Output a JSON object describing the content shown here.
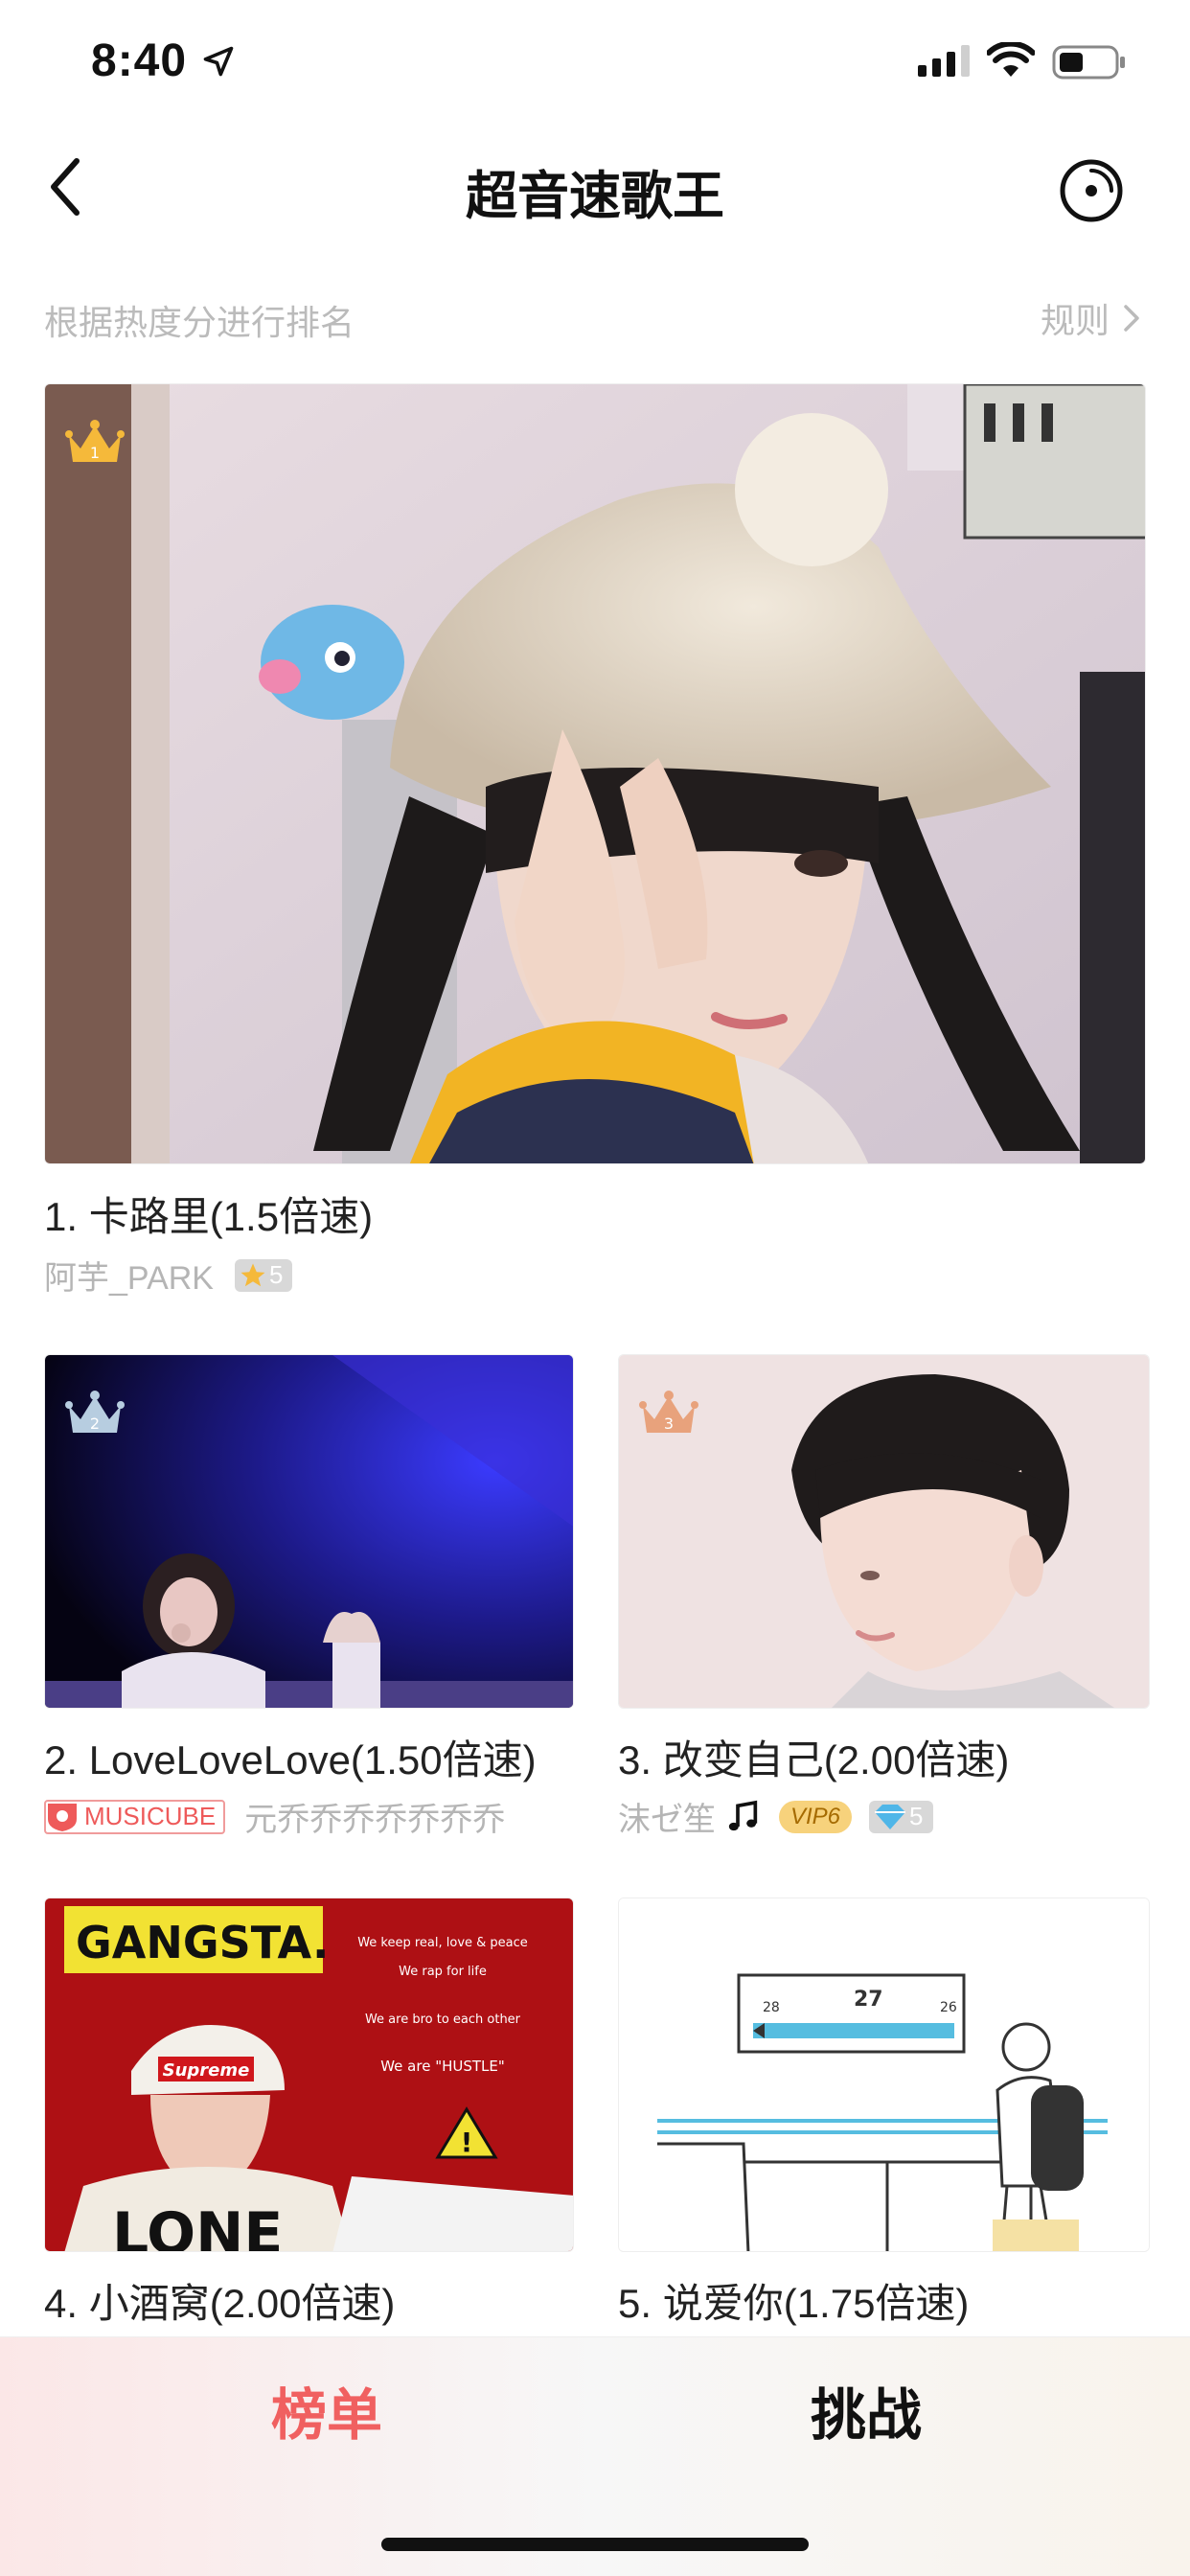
{
  "status_bar": {
    "time": "8:40"
  },
  "nav": {
    "title": "超音速歌王"
  },
  "subheader": {
    "description": "根据热度分进行排名",
    "rules_label": "规则"
  },
  "entries": [
    {
      "rank": "1",
      "title": "1. 卡路里(1.5倍速)",
      "user": "阿芋_PARK",
      "level": "5",
      "crown_color": "#f5b93a"
    },
    {
      "rank": "2",
      "title": "2. LoveLoveLove(1.50倍速)",
      "badge": "MUSICUBE",
      "user": "元乔乔乔乔乔乔乔",
      "crown_color": "#b7cde0"
    },
    {
      "rank": "3",
      "title": "3. 改变自己(2.00倍速)",
      "user": "沫ゼ笙",
      "vip": "VIP6",
      "level": "5",
      "crown_color": "#e8a27c"
    },
    {
      "rank": "",
      "title": "4. 小酒窝(2.00倍速)"
    },
    {
      "rank": "",
      "title": "5. 说爱你(1.75倍速)"
    }
  ],
  "poster_texts": {
    "gangsta": "GANGSTA.",
    "keep_real": "We keep real, love & peace",
    "rap_for_life": "We rap for life",
    "bro": "We are bro to each other",
    "hustle": "We are \"HUSTLE\"",
    "supreme": "Supreme",
    "train_num_left": "28",
    "train_num_mid": "27",
    "train_num_right": "26"
  },
  "tabs": {
    "rank": "榜单",
    "challenge": "挑战"
  },
  "colors": {
    "accent": "#f06060",
    "muted": "#bbbbbb",
    "gold": "#f5b93a"
  }
}
